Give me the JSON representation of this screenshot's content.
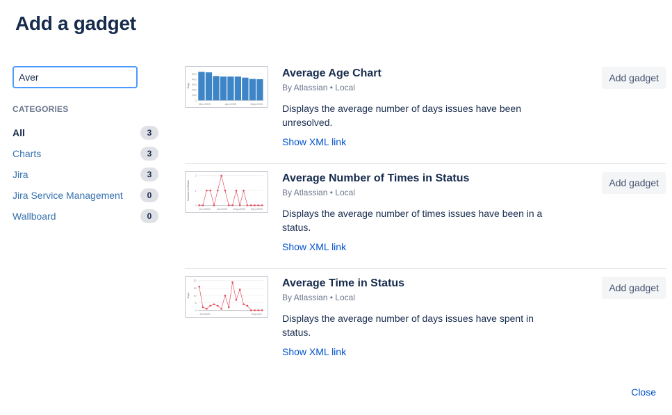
{
  "dialog": {
    "title": "Add a gadget",
    "close_label": "Close"
  },
  "search": {
    "value": "Aver",
    "placeholder": ""
  },
  "categories": {
    "heading": "CATEGORIES",
    "items": [
      {
        "label": "All",
        "count": "3",
        "active": true
      },
      {
        "label": "Charts",
        "count": "3",
        "active": false
      },
      {
        "label": "Jira",
        "count": "3",
        "active": false
      },
      {
        "label": "Jira Service Management",
        "count": "0",
        "active": false
      },
      {
        "label": "Wallboard",
        "count": "0",
        "active": false
      }
    ]
  },
  "gadgets": [
    {
      "name": "Average Age Chart",
      "author": "By Atlassian",
      "source": "Local",
      "separator": "•",
      "description": "Displays the average number of days issues have been unresolved.",
      "xml_link": "Show XML link",
      "add_label": "Add gadget",
      "thumbnail": {
        "type": "bar",
        "ylabel": "Days",
        "yticks": [
          "0",
          "100",
          "200",
          "300",
          "400",
          "500"
        ],
        "xticks": [
          "Mar-2009",
          "Apr-2009",
          "May-2009"
        ],
        "values": [
          540,
          530,
          460,
          450,
          450,
          450,
          430,
          405,
          400
        ],
        "ymax": 560,
        "color": "#3d85c6"
      }
    },
    {
      "name": "Average Number of Times in Status",
      "author": "By Atlassian",
      "source": "Local",
      "separator": "•",
      "description": "Displays the average number of times issues have been in a status.",
      "xml_link": "Show XML link",
      "add_label": "Add gadget",
      "thumbnail": {
        "type": "line",
        "ylabel": "Number in Status",
        "yticks": [
          "0",
          "1",
          "2"
        ],
        "xticks": [
          "Jun-2009",
          "Jul-2009",
          "Aug-2009",
          "Sep-2009"
        ],
        "values": [
          0,
          0,
          1,
          1,
          0,
          1,
          2,
          1,
          0,
          0,
          1,
          0,
          1,
          0,
          0,
          0,
          0,
          0
        ],
        "ymax": 2,
        "color": "#e0505f"
      }
    },
    {
      "name": "Average Time in Status",
      "author": "By Atlassian",
      "source": "Local",
      "separator": "•",
      "description": "Displays the average number of days issues have spent in status.",
      "xml_link": "Show XML link",
      "add_label": "Add gadget",
      "thumbnail": {
        "type": "line",
        "ylabel": "Days",
        "yticks": [
          "0",
          "5",
          "10",
          "15",
          "20"
        ],
        "xticks": [
          "Jul-2009",
          "Sep-200"
        ],
        "values": [
          16,
          2,
          1,
          3,
          4,
          3,
          1,
          10,
          2,
          19,
          7,
          14,
          4,
          3,
          0,
          0,
          0,
          0
        ],
        "ymax": 20,
        "color": "#e0505f"
      }
    }
  ]
}
